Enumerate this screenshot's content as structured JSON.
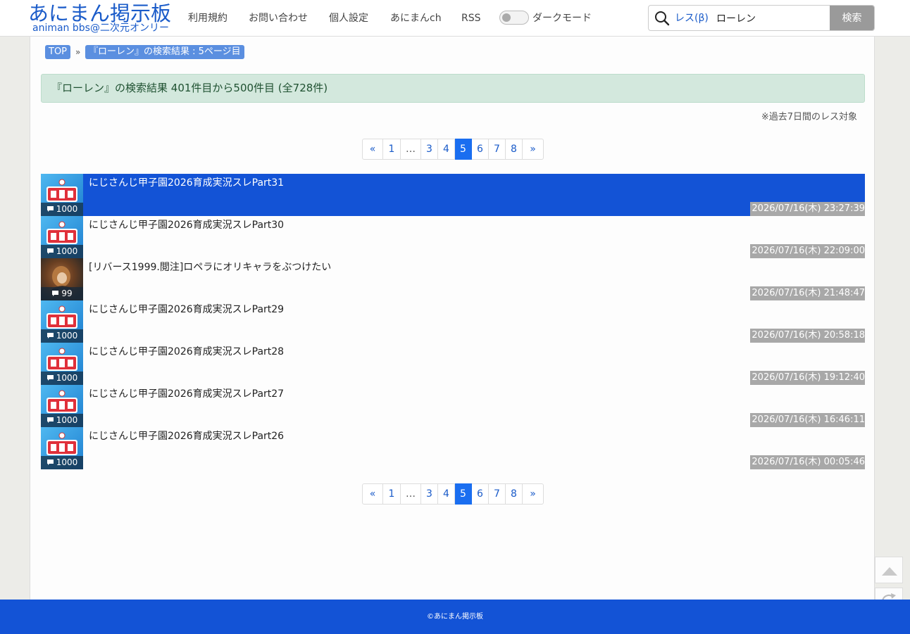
{
  "header": {
    "logo_main": "あにまん掲示板",
    "logo_sub": "animan bbs@二次元オンリー",
    "nav": [
      {
        "label": "利用規約"
      },
      {
        "label": "お問い合わせ"
      },
      {
        "label": "個人設定"
      },
      {
        "label": "あにまんch"
      },
      {
        "label": "RSS"
      }
    ],
    "dark_mode_label": "ダークモード",
    "search": {
      "scope": "レス(β)",
      "value": "ローレン",
      "button": "検索"
    }
  },
  "breadcrumb": {
    "top": "TOP",
    "separator": "»",
    "current": "『ローレン』の検索結果 : 5ページ目"
  },
  "result_summary": "『ローレン』の検索結果 401件目から500件目 (全728件)",
  "note": "※過去7日間のレス対象",
  "pagination": {
    "first": "«",
    "last": "»",
    "items": [
      "1",
      "…",
      "3",
      "4",
      "5",
      "6",
      "7",
      "8"
    ],
    "current": "5"
  },
  "threads": [
    {
      "title": "にじさんじ甲子園2026育成実況スレPart31",
      "count": "1000",
      "date": "2026/07/16(木) 23:27:39",
      "thumb": "koshien"
    },
    {
      "title": "にじさんじ甲子園2026育成実況スレPart30",
      "count": "1000",
      "date": "2026/07/16(木) 22:09:00",
      "thumb": "koshien"
    },
    {
      "title": "[リバース1999.閲注]ロペラにオリキャラをぶつけたい",
      "count": "99",
      "date": "2026/07/16(木) 21:48:47",
      "thumb": "character"
    },
    {
      "title": "にじさんじ甲子園2026育成実況スレPart29",
      "count": "1000",
      "date": "2026/07/16(木) 20:58:18",
      "thumb": "koshien"
    },
    {
      "title": "にじさんじ甲子園2026育成実況スレPart28",
      "count": "1000",
      "date": "2026/07/16(木) 19:12:40",
      "thumb": "koshien"
    },
    {
      "title": "にじさんじ甲子園2026育成実況スレPart27",
      "count": "1000",
      "date": "2026/07/16(木) 16:46:11",
      "thumb": "koshien"
    },
    {
      "title": "にじさんじ甲子園2026育成実況スレPart26",
      "count": "1000",
      "date": "2026/07/16(木) 00:05:46",
      "thumb": "koshien"
    }
  ],
  "footer": "©あにまん掲示板",
  "colors": {
    "brand": "#1a5bc9",
    "highlight_row": "#1353d6",
    "active_page": "#1a6ef0",
    "result_bar": "#d3e8dd",
    "date_badge": "#a8a8a8"
  },
  "icons": [
    "search-icon",
    "comment-icon",
    "scroll-top-icon",
    "reload-icon"
  ]
}
